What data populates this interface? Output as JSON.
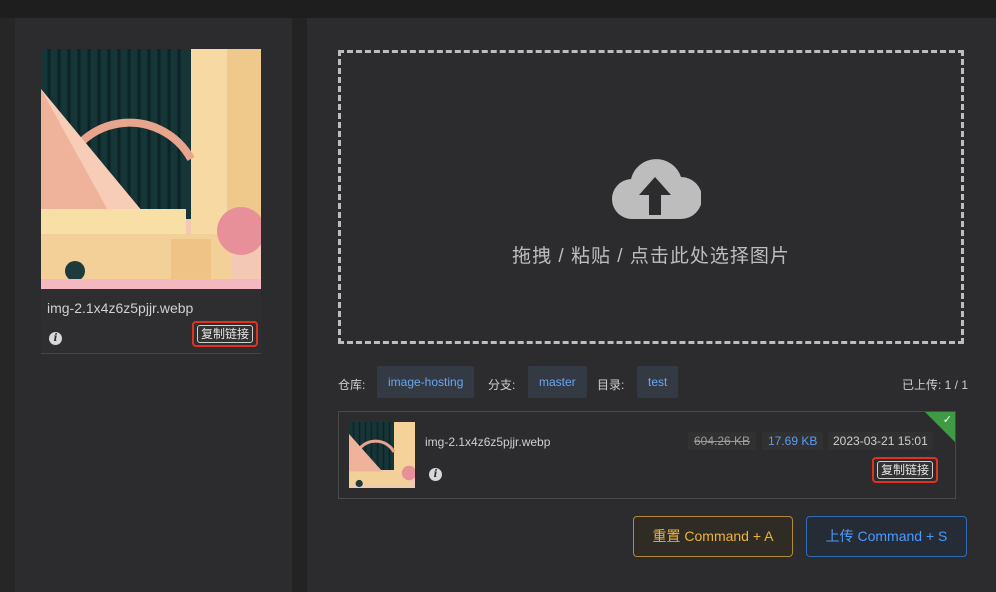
{
  "card": {
    "filename": "img-2.1x4z6z5pjjr.webp",
    "copy_label": "复制链接",
    "info_glyph": "i"
  },
  "dropzone": {
    "text": "拖拽 / 粘贴 / 点击此处选择图片"
  },
  "repo": {
    "repo_label": "仓库:",
    "repo_value": "image-hosting",
    "branch_label": "分支:",
    "branch_value": "master",
    "dir_label": "目录:",
    "dir_value": "test",
    "upload_count": "已上传: 1 / 1"
  },
  "item": {
    "filename": "img-2.1x4z6z5pjjr.webp",
    "original_size": "604.26 KB",
    "compressed_size": "17.69 KB",
    "datetime": "2023-03-21 15:01",
    "copy_label": "复制链接",
    "info_glyph": "i",
    "check_glyph": "✓"
  },
  "buttons": {
    "reset": "重置 Command + A",
    "upload": "上传 Command + S"
  },
  "colors": {
    "accent_blue": "#4a9bff",
    "accent_orange": "#f0b23a",
    "highlight_red": "#e0321e",
    "success_green": "#3e9b44"
  }
}
